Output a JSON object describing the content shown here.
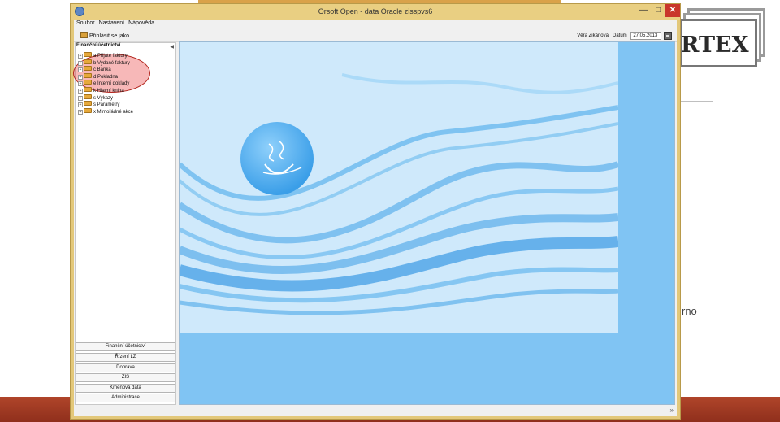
{
  "window": {
    "title": "Orsoft Open - data Oracle zisspvs6"
  },
  "menu": [
    "Soubor",
    "Nastavení",
    "Nápověda"
  ],
  "toolbar": {
    "login_label": "Přihlásit se jako..."
  },
  "user": {
    "name": "Věra Zikánová",
    "date_label": "Datum",
    "date_value": "27.05.2013"
  },
  "nav": {
    "header": "Finanční účetnictví",
    "tree": [
      "a Přijaté faktury",
      "b Vydané faktury",
      "c Banka",
      "d Pokladna",
      "e Interní doklady",
      "k Hlavní kniha",
      "s Výkazy",
      "s Parametry",
      "x Mimořádné akce"
    ],
    "modules": [
      "Finanční účetnictví",
      "Řízení LZ",
      "Doprava",
      "ZIS",
      "Kmenová data",
      "Administrace"
    ]
  },
  "slide": {
    "logo_text": "RTEX",
    "snippet": "rno"
  },
  "colors": {
    "accent_title": "#e9cf82",
    "close_red": "#c9362b",
    "highlight": "#e62828",
    "main_blue": "#80c4f3"
  },
  "icons": {
    "statusbar": "double-chevron-down-icon"
  }
}
